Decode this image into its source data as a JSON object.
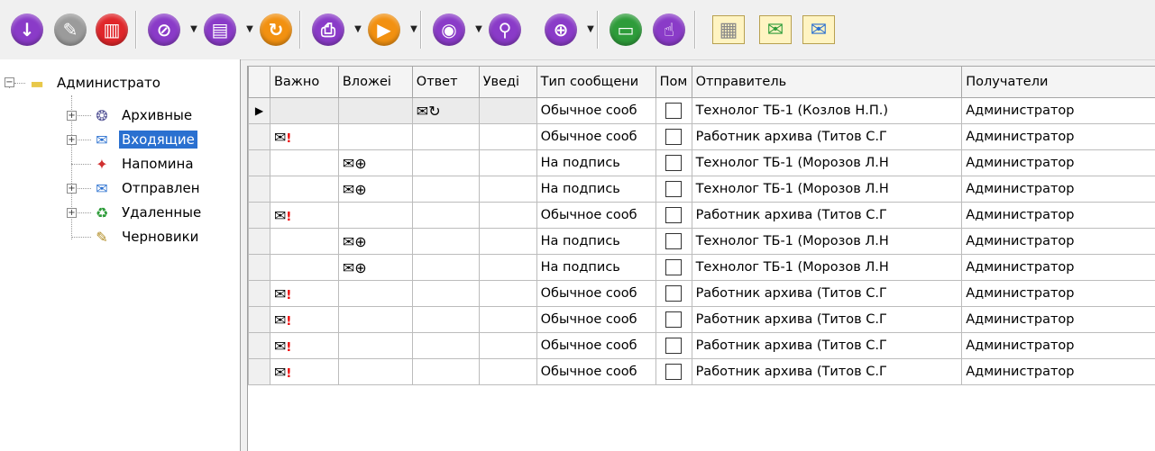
{
  "toolbar": {
    "buttons": [
      {
        "name": "download-icon",
        "glyph": "↓",
        "color": "#8a3bc8"
      },
      {
        "name": "edit-icon",
        "glyph": "✎",
        "color": "#9b9b9b"
      },
      {
        "name": "trash-icon",
        "glyph": "▥",
        "color": "#e0262a"
      },
      {
        "name": "link-icon",
        "glyph": "⊘",
        "color": "#8a3bc8"
      },
      {
        "name": "document-icon",
        "glyph": "▤",
        "color": "#8a3bc8"
      },
      {
        "name": "refresh-icon",
        "glyph": "↻",
        "color": "#f29111"
      },
      {
        "name": "print-icon",
        "glyph": "⎙",
        "color": "#8a3bc8"
      },
      {
        "name": "play-icon",
        "glyph": "▶",
        "color": "#f29111"
      },
      {
        "name": "eye-icon",
        "glyph": "◉",
        "color": "#8a3bc8"
      },
      {
        "name": "search-icon",
        "glyph": "⚲",
        "color": "#8a3bc8"
      },
      {
        "name": "globe-icon",
        "glyph": "⊕",
        "color": "#8a3bc8"
      },
      {
        "name": "folder-open-icon",
        "glyph": "▭",
        "color": "#2e9c3a"
      },
      {
        "name": "touch-icon",
        "glyph": "☝",
        "color": "#8a3bc8"
      }
    ],
    "mail_buttons": [
      {
        "name": "mail-grid-icon",
        "glyph": "▦"
      },
      {
        "name": "mail-reply-icon",
        "glyph": "✉"
      },
      {
        "name": "mail-forward-icon",
        "glyph": "✉"
      }
    ]
  },
  "tree": {
    "root": "Администрато",
    "items": [
      {
        "label": "Архивные",
        "icon": "archive-folder-icon",
        "glyph": "❂",
        "expandable": true
      },
      {
        "label": "Входящие",
        "icon": "inbox-icon",
        "glyph": "✉",
        "expandable": true,
        "selected": true
      },
      {
        "label": "Напомина",
        "icon": "reminder-icon",
        "glyph": "✦",
        "expandable": false
      },
      {
        "label": "Отправлен",
        "icon": "sent-icon",
        "glyph": "✉",
        "expandable": true
      },
      {
        "label": "Удаленные",
        "icon": "recycle-bin-icon",
        "glyph": "♻",
        "expandable": true
      },
      {
        "label": "Черновики",
        "icon": "drafts-icon",
        "glyph": "✎",
        "expandable": false
      }
    ]
  },
  "grid": {
    "columns": [
      "Важно",
      "Вложеі",
      "Ответ",
      "Уведі",
      "Тип сообщени",
      "Пом",
      "Отправитель",
      "Получатели"
    ],
    "rows": [
      {
        "important": false,
        "attach": false,
        "reply": true,
        "type": "Обычное сооб",
        "sender": "Технолог ТБ-1 (Козлов Н.П.)",
        "recipient": "Администратор",
        "current": true
      },
      {
        "important": true,
        "attach": false,
        "reply": false,
        "type": "Обычное сооб",
        "sender": "Работник архива (Титов С.Г",
        "recipient": "Администратор"
      },
      {
        "important": false,
        "attach": true,
        "reply": false,
        "type": "На подпись",
        "sender": "Технолог ТБ-1 (Морозов Л.Н",
        "recipient": "Администратор"
      },
      {
        "important": false,
        "attach": true,
        "reply": false,
        "type": "На подпись",
        "sender": "Технолог ТБ-1 (Морозов Л.Н",
        "recipient": "Администратор"
      },
      {
        "important": true,
        "attach": false,
        "reply": false,
        "type": "Обычное сооб",
        "sender": "Работник архива (Титов С.Г",
        "recipient": "Администратор"
      },
      {
        "important": false,
        "attach": true,
        "reply": false,
        "type": "На подпись",
        "sender": "Технолог ТБ-1 (Морозов Л.Н",
        "recipient": "Администратор"
      },
      {
        "important": false,
        "attach": true,
        "reply": false,
        "type": "На подпись",
        "sender": "Технолог ТБ-1 (Морозов Л.Н",
        "recipient": "Администратор"
      },
      {
        "important": true,
        "attach": false,
        "reply": false,
        "type": "Обычное сооб",
        "sender": "Работник архива (Титов С.Г",
        "recipient": "Администратор"
      },
      {
        "important": true,
        "attach": false,
        "reply": false,
        "type": "Обычное сооб",
        "sender": "Работник архива (Титов С.Г",
        "recipient": "Администратор"
      },
      {
        "important": true,
        "attach": false,
        "reply": false,
        "type": "Обычное сооб",
        "sender": "Работник архива (Титов С.Г",
        "recipient": "Администратор"
      },
      {
        "important": true,
        "attach": false,
        "reply": false,
        "type": "Обычное сооб",
        "sender": "Работник архива (Титов С.Г",
        "recipient": "Администратор"
      }
    ]
  }
}
